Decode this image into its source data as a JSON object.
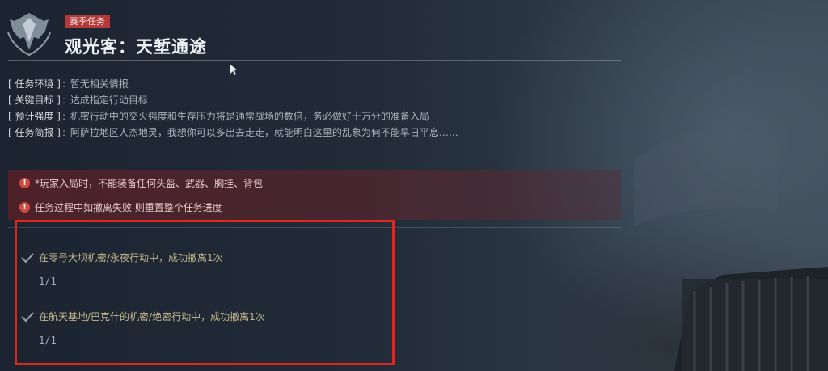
{
  "header": {
    "badge": "赛季任务",
    "title": "观光客：天堑通途"
  },
  "info": [
    {
      "key": "[ 任务环境 ]",
      "colon": ":",
      "value": "暂无相关情报"
    },
    {
      "key": "[ 关键目标 ]",
      "colon": ":",
      "value": "达成指定行动目标"
    },
    {
      "key": "[ 预计强度 ]",
      "colon": ":",
      "value": "机密行动中的交火强度和生存压力将是通常战场的数倍，务必做好十万分的准备入局"
    },
    {
      "key": "[ 任务简报 ]",
      "colon": ":",
      "value": "阿萨拉地区人杰地灵，我想你可以多出去走走，就能明白这里的乱象为何不能早日平息……"
    }
  ],
  "warnings": [
    {
      "icon": "!",
      "text": "*玩家入局时，不能装备任何头盔、武器、胸挂、背包"
    },
    {
      "icon": "!",
      "text": "任务过程中如撤离失败 则重置整个任务进度"
    }
  ],
  "objectives": [
    {
      "text": "在零号大坝机密/永夜行动中，成功撤离1次",
      "progress": "1/1"
    },
    {
      "text": "在航天基地/巴克什的机密/绝密行动中，成功撤离1次",
      "progress": "1/1"
    }
  ],
  "colors": {
    "badge": "#b23a3a",
    "highlight": "#e0261f",
    "warning_bg": "#782023",
    "objective_text": "#c4b78c"
  }
}
